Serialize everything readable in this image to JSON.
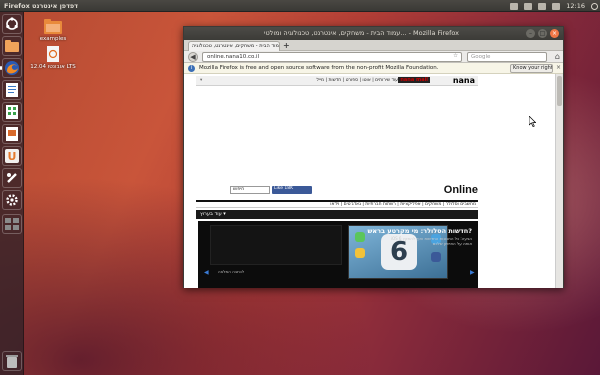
{
  "top_panel": {
    "app_title": "Firefox ‏ דפדפן אינטרנט",
    "clock": "12:16"
  },
  "launcher": {
    "items": [
      {
        "name": "dash-home",
        "glyph": "",
        "color": "#d9511f"
      },
      {
        "name": "home-folder",
        "glyph": "",
        "color": "#e28b3a"
      },
      {
        "name": "firefox",
        "glyph": "",
        "color": "#e06a1e"
      },
      {
        "name": "libreoffice-writer",
        "glyph": "",
        "color": "#3b78c4"
      },
      {
        "name": "libreoffice-calc",
        "glyph": "",
        "color": "#3aa34c"
      },
      {
        "name": "libreoffice-impress",
        "glyph": "",
        "color": "#d86a2c"
      },
      {
        "name": "ubuntu-software-center",
        "glyph": "U",
        "color": "#e57a2e"
      },
      {
        "name": "ubuntu-one",
        "glyph": "",
        "color": "#cf4b2a"
      },
      {
        "name": "system-settings",
        "glyph": "",
        "color": "#c9462a"
      },
      {
        "name": "workspace-switcher",
        "glyph": "",
        "color": "#3b3a3a"
      },
      {
        "name": "trash",
        "glyph": "",
        "color": "#6a6a6a"
      }
    ]
  },
  "desktop": {
    "icons": [
      {
        "label": "examples"
      },
      {
        "label": "אובונטו 12.04 LTS"
      }
    ]
  },
  "window": {
    "title": "עמוד הבית - משחקים, אינטרנט, טכנולוגיה ומולטי... - Mozilla Firefox",
    "tab_label": "עמוד הבית - משחקים, אינטרנט, טכנולוגיה...",
    "url": "online.nana10.co.il",
    "search_placeholder": "Google",
    "notification": "Mozilla Firefox is free and open source software from the non-profit Mozilla Foundation.",
    "rights_button": "Know your rights..."
  },
  "page": {
    "brand": "nana",
    "brand2": "nana mail",
    "top_links": "עוד שירותים | אוטו | ספורט | חדשות | מייל",
    "online_title": "Online",
    "search_box": "חיפוש",
    "facebook": "Like 18K",
    "categories": "מחשבים וסלולר | משחקים | אפליקציות | רשתות חברתיות | גאדג'טים | וידאו",
    "more_label": "עוד בערוץ ▾",
    "hero_headline": "חדשות הסלולר: מי מקרטע בראש?",
    "hero_text": "iOS 6 הגיעה: כל התכונות החדשות ואיך להתקין אותה על האייפון שלכם",
    "hero_caption": "לכתבה המלאה",
    "hero_glyph": "6"
  }
}
